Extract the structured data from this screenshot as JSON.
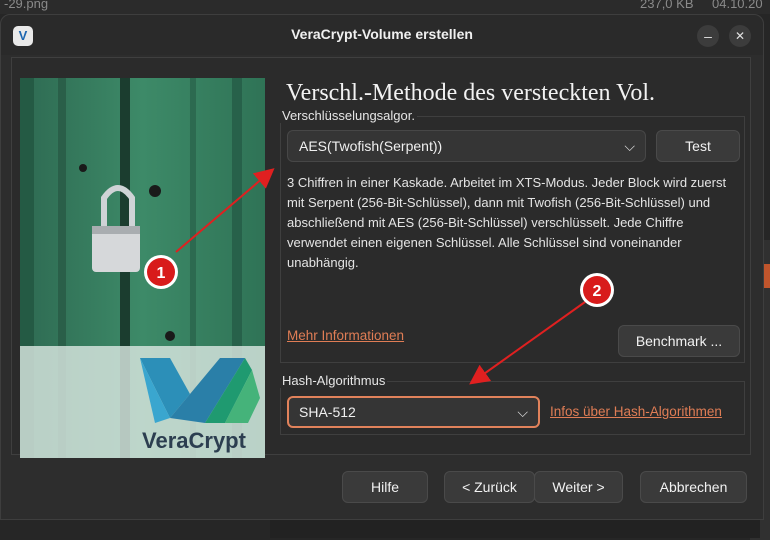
{
  "background": {
    "top_filename": "-29.png",
    "top_size": "237,0 KB",
    "top_date": "04.10.20"
  },
  "window": {
    "title": "VeraCrypt-Volume erstellen",
    "minimize_glyph": "–",
    "close_glyph": "✕"
  },
  "page": {
    "heading": "Verschl.-Methode des versteckten Vol."
  },
  "encryption": {
    "group_label": "Verschlüsselungsalgor.",
    "selected_algorithm": "AES(Twofish(Serpent))",
    "test_button": "Test",
    "description": "3 Chiffren in einer Kaskade. Arbeitet im XTS-Modus. Jeder Block wird zuerst mit Serpent (256-Bit-Schlüssel), dann mit Twofish (256-Bit-Schlüssel) und abschließend mit AES (256-Bit-Schlüssel) verschlüsselt. Jede Chiffre verwendet einen eigenen Schlüssel. Alle Schlüssel sind voneinander unabhängig.",
    "more_info_link": "Mehr Informationen",
    "benchmark_button": "Benchmark ..."
  },
  "hash": {
    "group_label": "Hash-Algorithmus",
    "selected_hash": "SHA-512",
    "info_link": "Infos über Hash-Algorithmen"
  },
  "footer": {
    "help": "Hilfe",
    "back": "< Zurück",
    "next": "Weiter >",
    "cancel": "Abbrechen"
  },
  "picture": {
    "brand": "VeraCrypt"
  },
  "annotations": {
    "marker1": "1",
    "marker2": "2",
    "color": "#e02020"
  },
  "icons": {
    "app": "veracrypt-icon",
    "dropdown": "chevron-down-icon"
  }
}
